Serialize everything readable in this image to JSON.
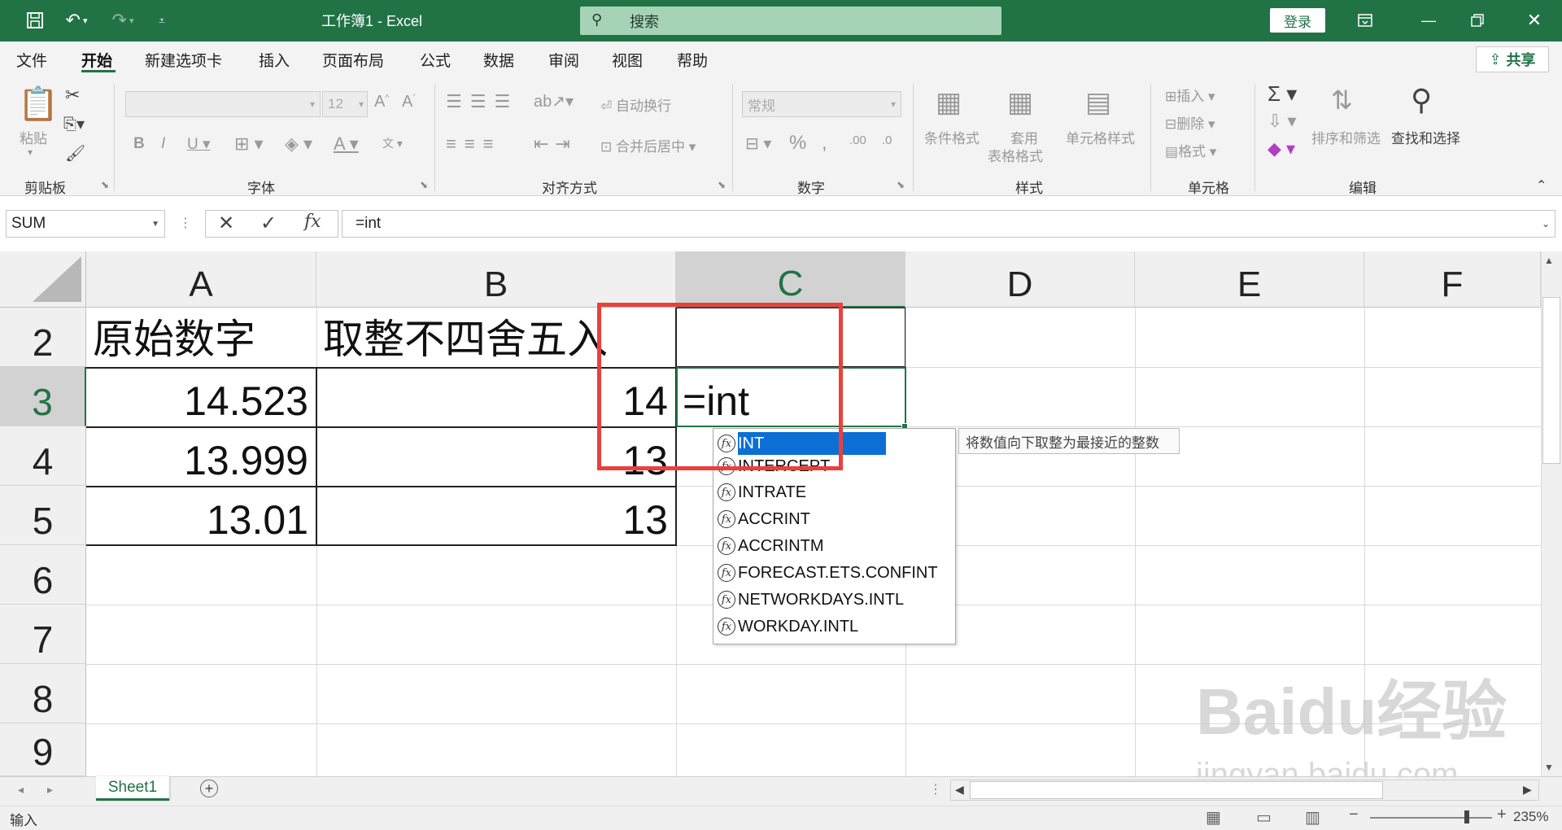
{
  "titlebar": {
    "title": "工作簿1  -  Excel",
    "search_placeholder": "搜索",
    "login": "登录"
  },
  "tabs": [
    "文件",
    "开始",
    "新建选项卡",
    "插入",
    "页面布局",
    "公式",
    "数据",
    "审阅",
    "视图",
    "帮助"
  ],
  "share": "共享",
  "ribbon": {
    "paste": "粘贴",
    "font_size": "12",
    "wrap_text": "自动换行",
    "merge_center": "合并后居中",
    "number_format": "常规",
    "conditional_format": "条件格式",
    "table_format_1": "套用",
    "table_format_2": "表格格式",
    "cell_style": "单元格样式",
    "insert": "插入",
    "delete": "删除",
    "format": "格式",
    "sort_filter": "排序和筛选",
    "find_select": "查找和选择",
    "groups": {
      "clipboard": "剪贴板",
      "font": "字体",
      "alignment": "对齐方式",
      "number": "数字",
      "styles": "样式",
      "cells": "单元格",
      "editing": "编辑"
    }
  },
  "formula_bar": {
    "name_box": "SUM",
    "formula": "=int"
  },
  "columns": [
    "A",
    "B",
    "C",
    "D",
    "E",
    "F"
  ],
  "rows": [
    "2",
    "3",
    "4",
    "5",
    "6",
    "7",
    "8",
    "9"
  ],
  "cells": {
    "A2": "原始数字",
    "B2": "取整不四舍五入",
    "A3": "14.523",
    "B3": "14",
    "C3": "=int",
    "A4": "13.999",
    "B4": "13",
    "A5": "13.01",
    "B5": "13"
  },
  "autocomplete": {
    "items": [
      "INT",
      "INTERCEPT",
      "INTRATE",
      "ACCRINT",
      "ACCRINTM",
      "FORECAST.ETS.CONFINT",
      "NETWORKDAYS.INTL",
      "WORKDAY.INTL"
    ],
    "tooltip": "将数值向下取整为最接近的整数"
  },
  "sheet_tab": "Sheet1",
  "status": {
    "mode": "输入",
    "zoom": "235%"
  },
  "watermark": "Baidu经验",
  "watermark_url": "jingyan.baidu.com",
  "colors": {
    "excel_green": "#217346",
    "highlight_red": "#e8413c",
    "selection_blue": "#0b6fd6"
  }
}
